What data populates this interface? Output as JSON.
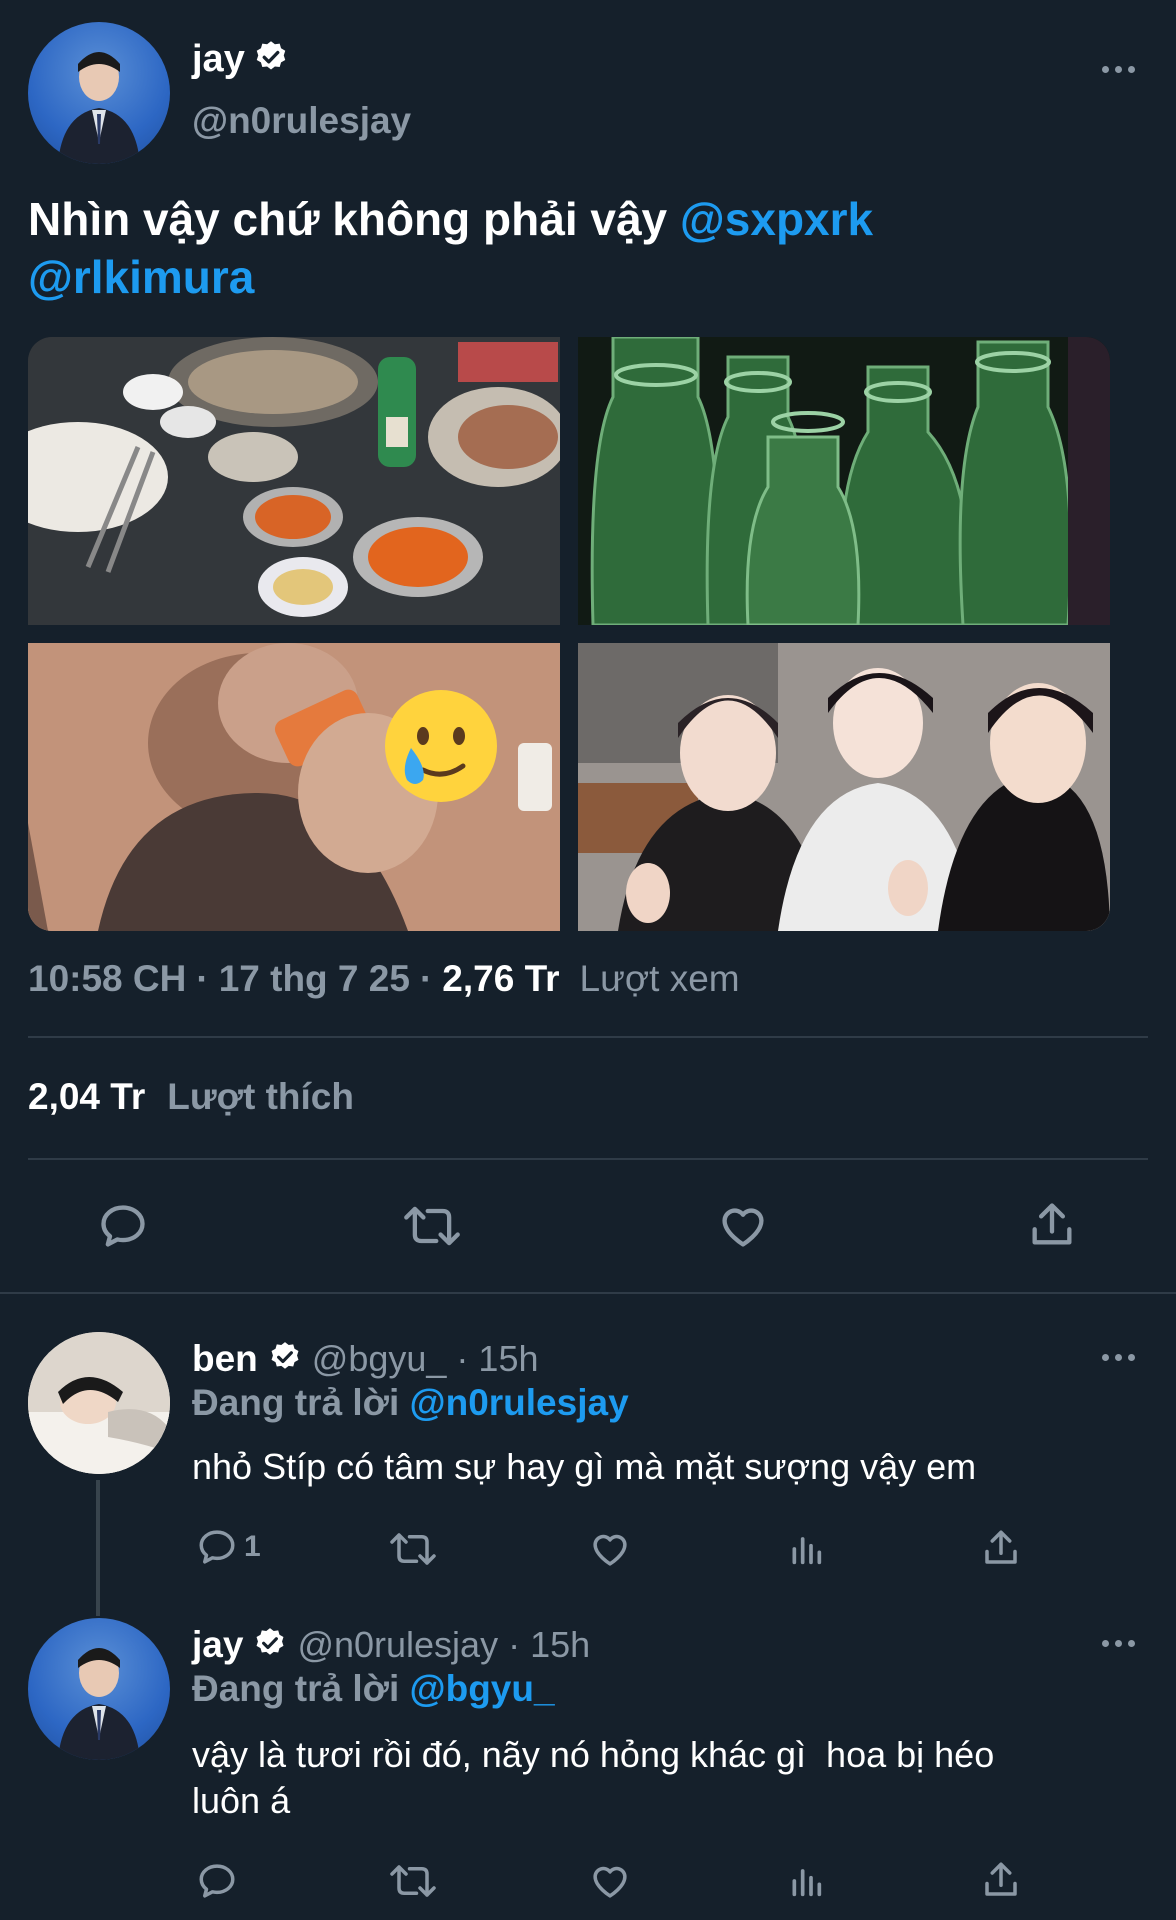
{
  "tweet": {
    "author_name": "jay",
    "author_handle": "@n0rulesjay",
    "text": "Nhìn vậy chứ không phải vậy",
    "mention_1": "@sxpxrk",
    "mention_2": "@rlkimura",
    "time": "10:58 CH",
    "date": "17 thg 7 25",
    "views_count": "2,76 Tr",
    "views_label": "Lượt xem",
    "likes_count": "2,04 Tr",
    "likes_label": "Lượt thích"
  },
  "reply_1": {
    "author_name": "ben",
    "author_handle": "@bgyu_",
    "time": "15h",
    "replying_label": "Đang trả lời",
    "replying_to": "@n0rulesjay",
    "text": "nhỏ Stíp có tâm sự hay gì mà mặt sượng vậy em",
    "reply_count": "1"
  },
  "reply_2": {
    "author_name": "jay",
    "author_handle": "@n0rulesjay",
    "time": "15h",
    "replying_label": "Đang trả lời",
    "replying_to": "@bgyu_",
    "text_line_1": "vậy là tươi rồi đó, nãy nó hỏng khác gì  hoa bị héo",
    "text_line_2": "luôn á"
  },
  "colors": {
    "background": "#15202b",
    "accent": "#1d9bf0",
    "muted": "#8b98a5"
  },
  "icons": [
    "verified-badge-icon",
    "more-icon",
    "reply-icon",
    "retweet-icon",
    "like-icon",
    "share-icon",
    "views-icon",
    "crying-face-emoji"
  ]
}
